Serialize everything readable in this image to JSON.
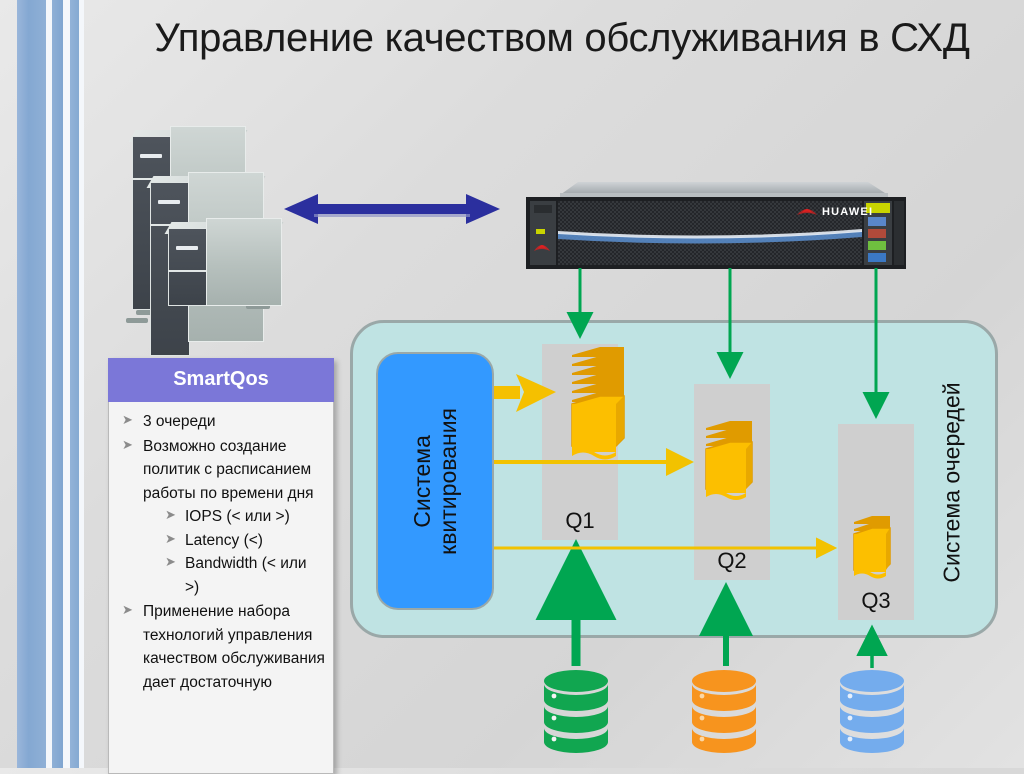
{
  "slide": {
    "title": "Управление качеством обслуживания в СХД",
    "background_color": "#dcdcdc"
  },
  "decor": {
    "stripe_color": "#84a8d2",
    "highlight_color": "#f4f7fb"
  },
  "connection_arrow": {
    "name": "double-headed-arrow",
    "color": "#2b2f9e",
    "direction": "bidirectional"
  },
  "servers": {
    "label": "server-towers",
    "count": 3,
    "face_color": "#444a52",
    "side_color": "#bfc8c6"
  },
  "storage_array": {
    "brand": "HUAWEI",
    "chassis_color": "#2a2d30",
    "accent_color": "#8fd400"
  },
  "panel": {
    "header": "SmartQos",
    "header_color": "#7b77d8",
    "bullet_glyph": "➤",
    "items": [
      {
        "text": "3 очереди",
        "children": []
      },
      {
        "text": "Возможно создание политик с расписанием работы по времени дня",
        "children": [
          "IOPS (< или >)",
          "Latency (<)",
          "Bandwidth (< или >)"
        ]
      },
      {
        "text": "Применение набора технологий управления качеством обслуживания дает достаточную",
        "children": []
      }
    ]
  },
  "queue_system": {
    "label": "Система очередей",
    "container_color": "#bfe3e3",
    "border_color": "#9aa8a8",
    "ack_box": {
      "label": "Система квитирования",
      "color": "#3399ff"
    },
    "queues": [
      {
        "id": "Q1",
        "stack_size": 8,
        "fill_color": "#f5b800"
      },
      {
        "id": "Q2",
        "stack_size": 5,
        "fill_color": "#f5b800"
      },
      {
        "id": "Q3",
        "stack_size": 3,
        "fill_color": "#f5b800"
      }
    ],
    "flow_arrow_color": "#f2c200",
    "ingest_arrow_color": "#00a651"
  },
  "databases": [
    {
      "name": "database-green",
      "color": "#11a650"
    },
    {
      "name": "database-orange",
      "color": "#f7941e"
    },
    {
      "name": "database-blue",
      "color": "#74aced"
    }
  ]
}
